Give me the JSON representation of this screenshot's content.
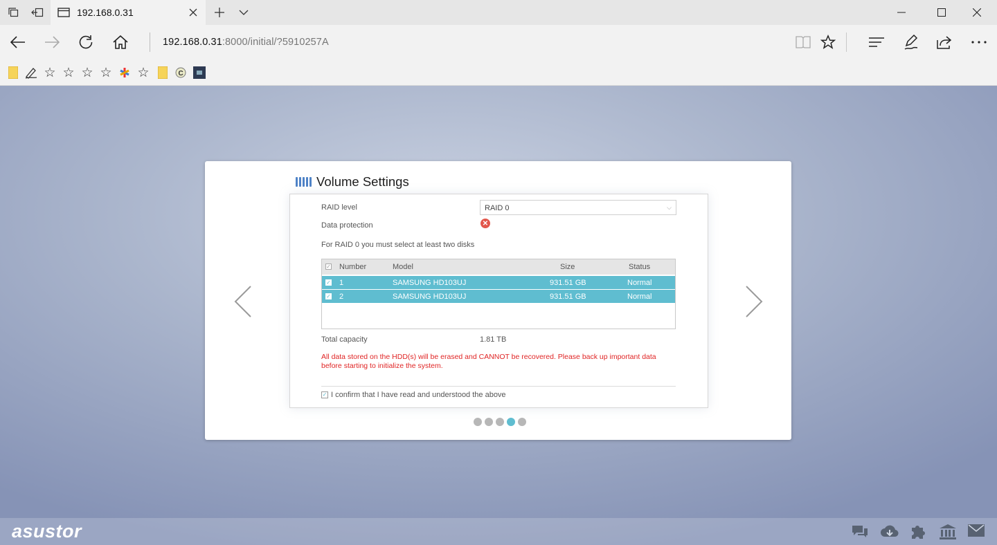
{
  "browser": {
    "tab_title": "192.168.0.31",
    "address_host": "192.168.0.31",
    "address_rest": ":8000/initial/?5910257A",
    "icons": [
      "tab-list-icon",
      "back-tab-icon",
      "page-icon",
      "close-icon",
      "new-tab-icon",
      "chevron-down-icon",
      "minimize-icon",
      "maximize-icon",
      "window-close-icon",
      "back-icon",
      "forward-icon",
      "refresh-icon",
      "home-icon",
      "reading-view-icon",
      "favorite-star-icon",
      "hub-icon",
      "web-note-icon",
      "share-icon",
      "more-icon"
    ]
  },
  "favorites": [
    {
      "icon": "folder-icon"
    },
    {
      "icon": "pen-icon"
    },
    {
      "icon": "star-icon"
    },
    {
      "icon": "star-icon"
    },
    {
      "icon": "star-icon"
    },
    {
      "icon": "star-icon"
    },
    {
      "icon": "asterisk-icon"
    },
    {
      "icon": "star-icon"
    },
    {
      "icon": "folder-icon"
    },
    {
      "icon": "circle-c-icon"
    },
    {
      "icon": "square-app-icon"
    }
  ],
  "wizard": {
    "title": "Volume Settings",
    "raid_level_label": "RAID level",
    "raid_level_value": "RAID 0",
    "data_protection_label": "Data protection",
    "hint": "For RAID 0 you must select at least two disks",
    "columns": {
      "number": "Number",
      "model": "Model",
      "size": "Size",
      "status": "Status"
    },
    "disks": [
      {
        "number": "1",
        "model": "SAMSUNG HD103UJ",
        "size": "931.51 GB",
        "status": "Normal"
      },
      {
        "number": "2",
        "model": "SAMSUNG HD103UJ",
        "size": "931.51 GB",
        "status": "Normal"
      }
    ],
    "total_capacity_label": "Total capacity",
    "total_capacity_value": "1.81 TB",
    "warning": "All data stored on the HDD(s) will be erased and CANNOT be recovered. Please back up important data before starting to initialize the system.",
    "confirm_label": "I confirm that I have read and understood the above",
    "step_current": 4,
    "step_total": 5
  },
  "footer": {
    "brand": "asustor",
    "icons": [
      "chat-icon",
      "cloud-download-icon",
      "puzzle-icon",
      "bank-icon",
      "mail-icon"
    ]
  },
  "colors": {
    "accent": "#5fbdd0",
    "error": "#e02424",
    "brand_icon": "#4f83c7"
  }
}
